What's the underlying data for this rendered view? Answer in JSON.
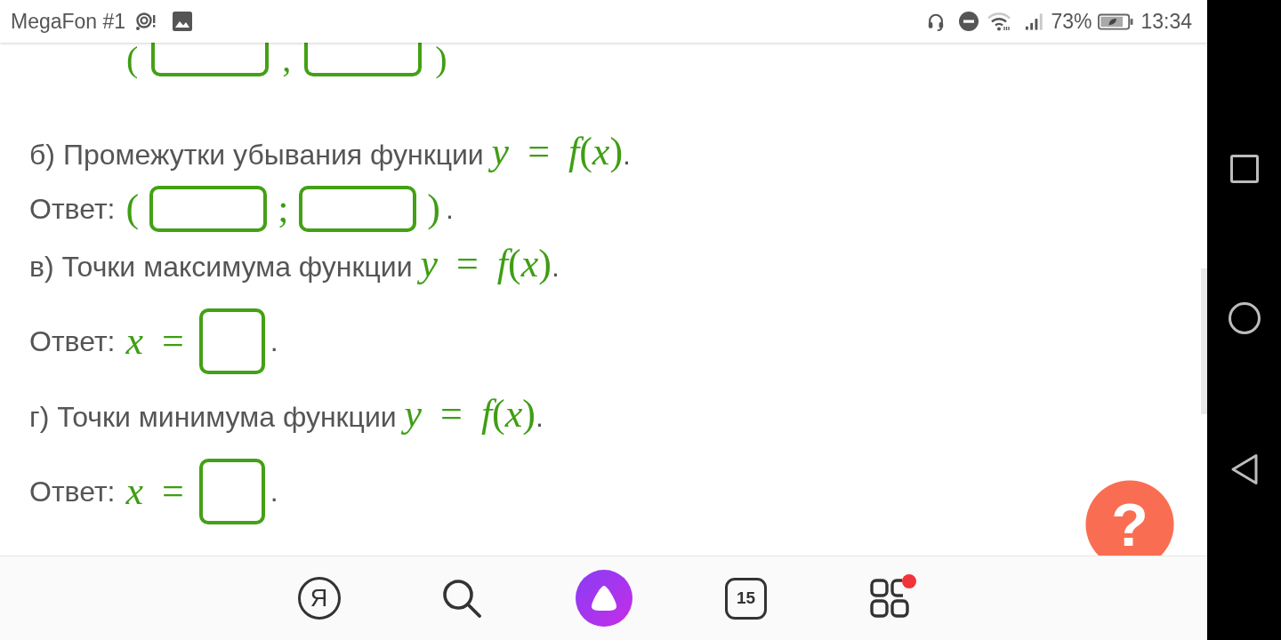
{
  "status_bar": {
    "carrier": "MegaFon #1",
    "battery": "73%",
    "time": "13:34"
  },
  "lines": [
    {
      "kind": "formula",
      "parts": [
        {
          "kind": "math",
          "text": "("
        },
        {
          "kind": "wide_field"
        },
        {
          "kind": "math",
          "text": ","
        },
        {
          "kind": "wide_field"
        },
        {
          "kind": "math",
          "text": ")"
        }
      ]
    },
    {
      "kind": "question",
      "parts": [
        {
          "kind": "text",
          "text": "б) Промежутки убывания функции"
        },
        {
          "kind": "math",
          "text": "*y* = *f*(*x*)"
        },
        {
          "kind": "text",
          "text": "."
        }
      ]
    },
    {
      "kind": "answer",
      "parts": [
        {
          "kind": "text",
          "text": "Ответ:"
        },
        {
          "kind": "math",
          "text": "("
        },
        {
          "kind": "wide_field"
        },
        {
          "kind": "math",
          "text": ";"
        },
        {
          "kind": "wide_field"
        },
        {
          "kind": "math",
          "text": ")"
        },
        {
          "kind": "text",
          "text": "."
        }
      ]
    },
    {
      "kind": "question",
      "parts": [
        {
          "kind": "text",
          "text": "в) Точки максимума функции"
        },
        {
          "kind": "math",
          "text": "*y* = *f*(*x*)"
        },
        {
          "kind": "text",
          "text": "."
        }
      ]
    },
    {
      "kind": "answer",
      "parts": [
        {
          "kind": "text",
          "text": "Ответ:"
        },
        {
          "kind": "math",
          "text": "*x* ="
        },
        {
          "kind": "square_field"
        },
        {
          "kind": "text",
          "text": "."
        }
      ]
    },
    {
      "kind": "question",
      "parts": [
        {
          "kind": "text",
          "text": "г) Точки минимума функции"
        },
        {
          "kind": "math",
          "text": "*y* = *f*(*x*)"
        },
        {
          "kind": "text",
          "text": "."
        }
      ]
    },
    {
      "kind": "answer",
      "parts": [
        {
          "kind": "text",
          "text": "Ответ:"
        },
        {
          "kind": "math",
          "text": "*x* ="
        },
        {
          "kind": "square_field"
        },
        {
          "kind": "text",
          "text": "."
        }
      ]
    }
  ],
  "help_button": {
    "label": "?"
  },
  "toolbar": [
    {
      "kind": "logo",
      "label": "Я"
    },
    {
      "kind": "search"
    },
    {
      "kind": "assistant"
    },
    {
      "kind": "tabs",
      "label": "15"
    },
    {
      "kind": "apps",
      "notification": true
    }
  ]
}
